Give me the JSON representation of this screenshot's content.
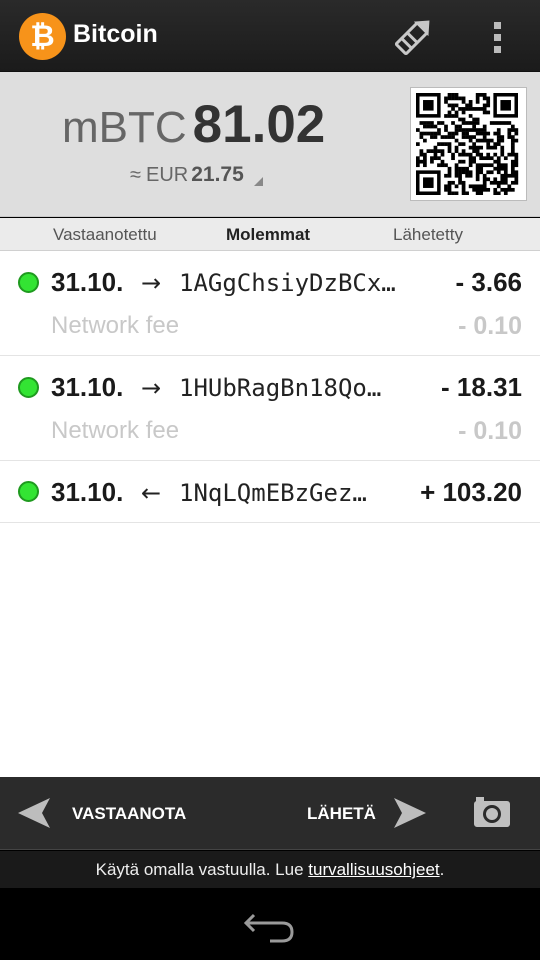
{
  "app_bar": {
    "title": "Bitcoin",
    "logo_glyph": "₿",
    "logo_color": "#f7931a",
    "icons": [
      "edit-icon",
      "overflow-menu-icon"
    ]
  },
  "balance": {
    "unit": "mBTC",
    "amount": "81.02",
    "fiat_approx": "≈",
    "fiat_currency": "EUR",
    "fiat_amount": "21.75"
  },
  "tabs": [
    {
      "label": "Vastaanotettu",
      "active": false
    },
    {
      "label": "Molemmat",
      "active": true
    },
    {
      "label": "Lähetetty",
      "active": false
    }
  ],
  "transactions": [
    {
      "date": "31.10.",
      "direction": "→",
      "address": "1AGgChsiyDzBCx…",
      "value": "- 3.66",
      "fee_label": "Network fee",
      "fee_value": "- 0.10",
      "status_color": "#33e433"
    },
    {
      "date": "31.10.",
      "direction": "→",
      "address": "1HUbRagBn18Qo…",
      "value": "- 18.31",
      "fee_label": "Network fee",
      "fee_value": "- 0.10",
      "status_color": "#33e433"
    },
    {
      "date": "31.10.",
      "direction": "←",
      "address": "1NqLQmEBzGez…",
      "value": "+ 103.20",
      "status_color": "#33e433"
    }
  ],
  "bottom_bar": {
    "receive_label": "VASTAANOTA",
    "send_label": "LÄHETÄ",
    "icons": [
      "arrow-left-icon",
      "arrow-right-icon",
      "camera-icon"
    ]
  },
  "disclaimer": {
    "text": "Käytä omalla vastuulla. Lue ",
    "link": "turvallisuusohjeet",
    "suffix": "."
  },
  "system_nav": {
    "icons": [
      "back-icon"
    ]
  }
}
